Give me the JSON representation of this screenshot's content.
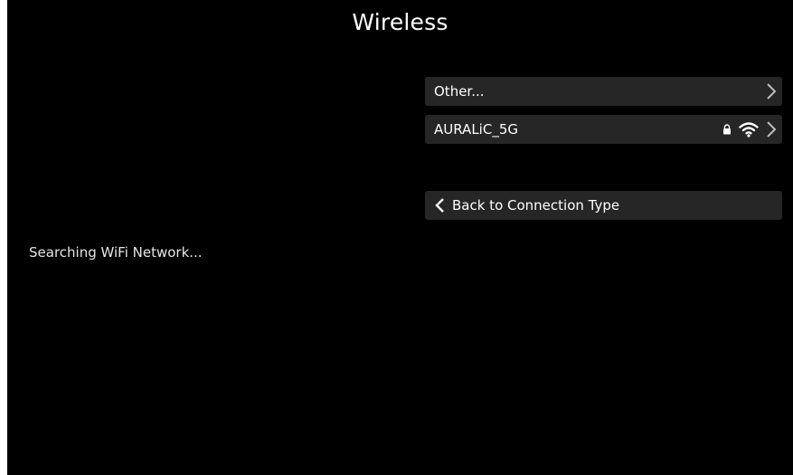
{
  "header": {
    "title": "Wireless"
  },
  "networks": [
    {
      "label": "Other...",
      "secured": false,
      "signal": false,
      "icon": "chevron-right-icon"
    },
    {
      "label": "AURALiC_5G",
      "secured": true,
      "signal": true,
      "icon": "chevron-right-icon"
    }
  ],
  "back_button": {
    "label": "Back to Connection Type",
    "icon": "chevron-left-icon"
  },
  "status": {
    "text": "Searching WiFi Network..."
  },
  "colors": {
    "background": "#000000",
    "row_background": "#262626",
    "text": "#ffffff"
  }
}
